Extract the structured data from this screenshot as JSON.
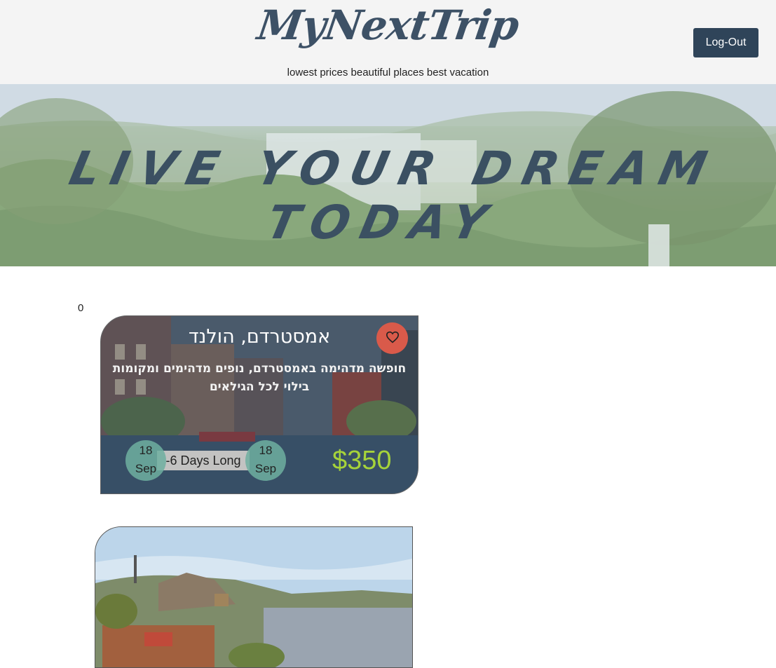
{
  "header": {
    "logo": "MyNextTrip",
    "tagline": "lowest prices beautiful places best vacation",
    "logout_label": "Log-Out"
  },
  "hero": {
    "headline": "LIVE YOUR DREAM TODAY"
  },
  "counter": "0",
  "vacations": [
    {
      "destination": "אמסטרדם, הולנד",
      "description": "חופשה מדהימה באמסטרדם, נופים מדהימים ומקומות בילוי לכל הגילאים",
      "start_day": "18",
      "start_month": "Sep",
      "duration": "-6 Days Long",
      "end_day": "18",
      "end_month": "Sep",
      "price": "$350",
      "favorite_icon": "heart-icon"
    }
  ],
  "colors": {
    "header_bg": "#f4f4f4",
    "logo": "#3d5166",
    "logout_bg": "#2f4459",
    "price": "#a6d33a",
    "favorite_bg": "#d95a4a"
  }
}
